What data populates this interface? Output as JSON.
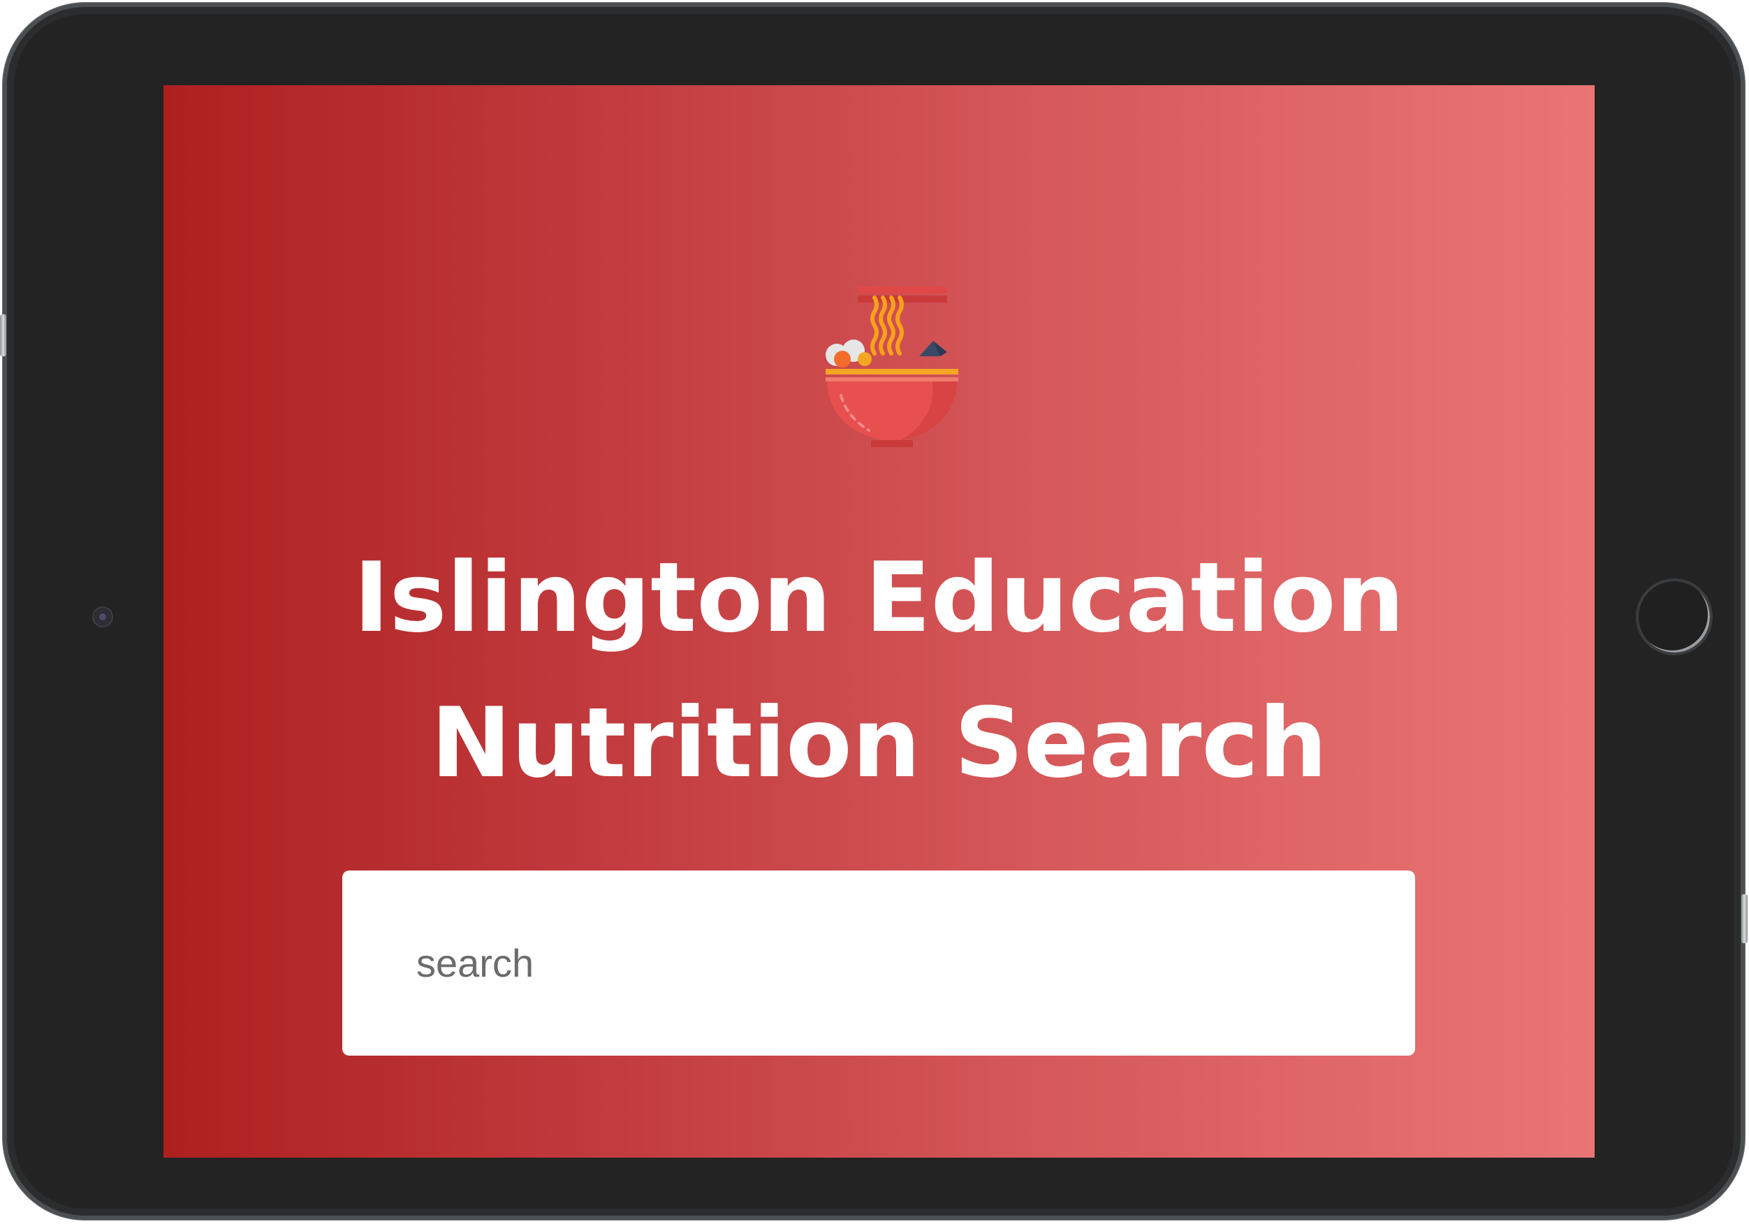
{
  "app": {
    "title_line1": "Islington Education",
    "title_line2": "Nutrition Search",
    "logo_icon": "noodle-bowl-icon"
  },
  "search": {
    "placeholder": "search",
    "value": ""
  },
  "device": {
    "camera_icon": "front-camera-icon",
    "home_button_icon": "home-button-icon"
  },
  "colors": {
    "gradient_start": "#ad2020",
    "gradient_end": "#ea7575",
    "title": "#ffffff",
    "bowl": "#e84f4f",
    "noodles": "#f5a623",
    "chopsticks": "#d94040"
  }
}
